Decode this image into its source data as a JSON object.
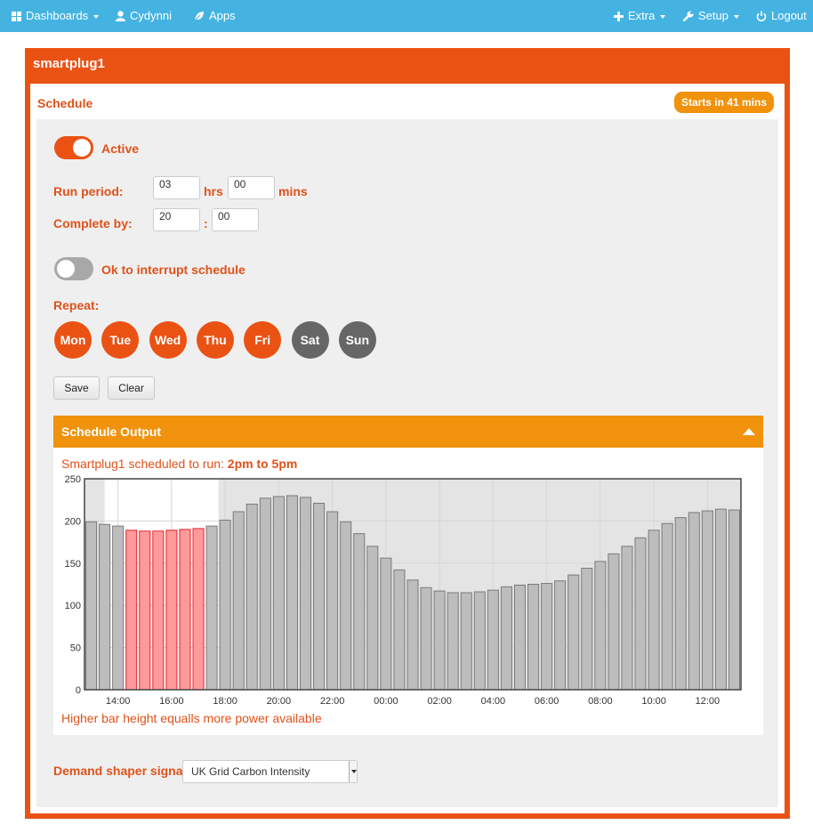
{
  "nav": {
    "dashboards": "Dashboards",
    "user": "Cydynni",
    "apps": "Apps",
    "extra": "Extra",
    "setup": "Setup",
    "logout": "Logout"
  },
  "device": {
    "title": "smartplug1"
  },
  "schedule": {
    "title": "Schedule",
    "badge": "Starts in 41 mins",
    "active_label": "Active",
    "active": true,
    "run_period_label": "Run period:",
    "run_hours": "03",
    "hrs_label": "hrs",
    "run_mins": "00",
    "mins_label": "mins",
    "complete_by_label": "Complete by:",
    "complete_hour": "20",
    "colon": ":",
    "complete_min": "00",
    "interrupt_label": "Ok to interrupt schedule",
    "interruptible": false,
    "repeat_label": "Repeat:",
    "days": [
      {
        "label": "Mon",
        "on": true
      },
      {
        "label": "Tue",
        "on": true
      },
      {
        "label": "Wed",
        "on": true
      },
      {
        "label": "Thu",
        "on": true
      },
      {
        "label": "Fri",
        "on": true
      },
      {
        "label": "Sat",
        "on": false
      },
      {
        "label": "Sun",
        "on": false
      }
    ],
    "save_label": "Save",
    "clear_label": "Clear"
  },
  "output": {
    "title": "Schedule Output",
    "scheduled_prefix": "Smartplug1 scheduled to run:",
    "scheduled_time": "2pm to 5pm",
    "footnote": "Higher bar height equalls more power available"
  },
  "demand": {
    "label": "Demand shaper signal:",
    "selected": "UK Grid Carbon Intensity"
  },
  "colors": {
    "accent": "#ea5214",
    "header_orange": "#f0920c",
    "nav_blue": "#44b3e2",
    "scheduled_bar": "#ff9a9a",
    "scheduled_bar_border": "#e8202a",
    "normal_bar": "#bdbdbd",
    "normal_bar_border": "#7a7a7a",
    "day_off": "#666666"
  },
  "chart_data": {
    "type": "bar",
    "title": "",
    "xlabel": "",
    "ylabel": "",
    "ylim": [
      0,
      250
    ],
    "yticks": [
      0,
      50,
      100,
      150,
      200,
      250
    ],
    "xtick_labels": [
      "14:00",
      "16:00",
      "18:00",
      "20:00",
      "22:00",
      "00:00",
      "02:00",
      "04:00",
      "06:00",
      "08:00",
      "10:00",
      "12:00"
    ],
    "x": [
      "13:00",
      "13:30",
      "14:00",
      "14:30",
      "15:00",
      "15:30",
      "16:00",
      "16:30",
      "17:00",
      "17:30",
      "18:00",
      "18:30",
      "19:00",
      "19:30",
      "20:00",
      "20:30",
      "21:00",
      "21:30",
      "22:00",
      "22:30",
      "23:00",
      "23:30",
      "00:00",
      "00:30",
      "01:00",
      "01:30",
      "02:00",
      "02:30",
      "03:00",
      "03:30",
      "04:00",
      "04:30",
      "05:00",
      "05:30",
      "06:00",
      "06:30",
      "07:00",
      "07:30",
      "08:00",
      "08:30",
      "09:00",
      "09:30",
      "10:00",
      "10:30",
      "11:00",
      "11:30",
      "12:00",
      "12:30"
    ],
    "values": [
      199,
      196,
      194,
      189,
      188,
      188,
      189,
      190,
      191,
      194,
      201,
      211,
      220,
      227,
      229,
      230,
      228,
      221,
      211,
      199,
      185,
      170,
      156,
      142,
      130,
      121,
      117,
      115,
      115,
      116,
      118,
      122,
      124,
      125,
      126,
      129,
      136,
      144,
      152,
      161,
      170,
      180,
      189,
      197,
      204,
      210,
      212,
      214,
      213
    ],
    "scheduled_from_index": 3,
    "scheduled_to_index": 8,
    "shaded_region": "before 14:00 and after 17:00",
    "grid": true
  }
}
